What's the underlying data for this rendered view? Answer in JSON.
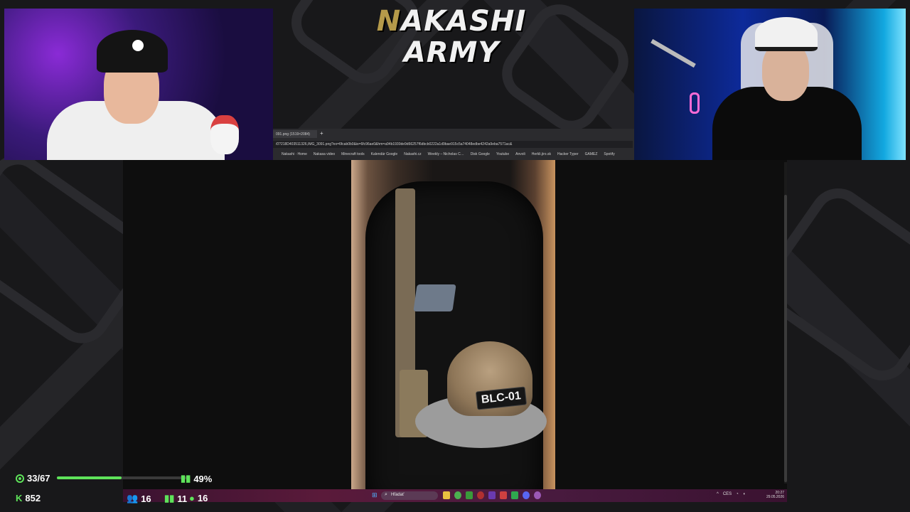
{
  "overlay": {
    "logo_line1_first": "N",
    "logo_line1_rest": "AKASHI",
    "logo_line2": "ARMY"
  },
  "browser": {
    "tab_title": "091.png (1519×2084)",
    "new_tab": "+",
    "url": "/0?218D403511326,IMG_3091.png?ex=6fcab0b0&is=6fc96ae0&hm=a94b1930de9d66257f6dbcb0222a1d9bae915c5a74048edbe4242a9eba7571ac&",
    "bookmarks": [
      "Nakashi · Home",
      "Nakasa video",
      "Minecraft tools",
      "Kalendár Google",
      "Nakashi.cz",
      "Weekly – Nicholas C…",
      "Disk Google",
      "Youtube",
      "Anvoli",
      "Herkli.jiro.sk",
      "Hacker Typer",
      "GAMEZ",
      "Spotify"
    ]
  },
  "photo": {
    "patch_text": "BLC-01"
  },
  "taskbar": {
    "start_icon": "windows-icon",
    "search_label": "Hľadať",
    "time": "20:27",
    "date": "29.05.2026",
    "lang": "CES"
  },
  "stats": {
    "followers": "33/67",
    "goal_percent": "49%",
    "goal_fraction": 0.49,
    "points": "852",
    "community": "16",
    "bars_count": "11",
    "drops": "16"
  },
  "colors": {
    "accent": "#5ee35a",
    "taskbar": "#4a1b40"
  }
}
